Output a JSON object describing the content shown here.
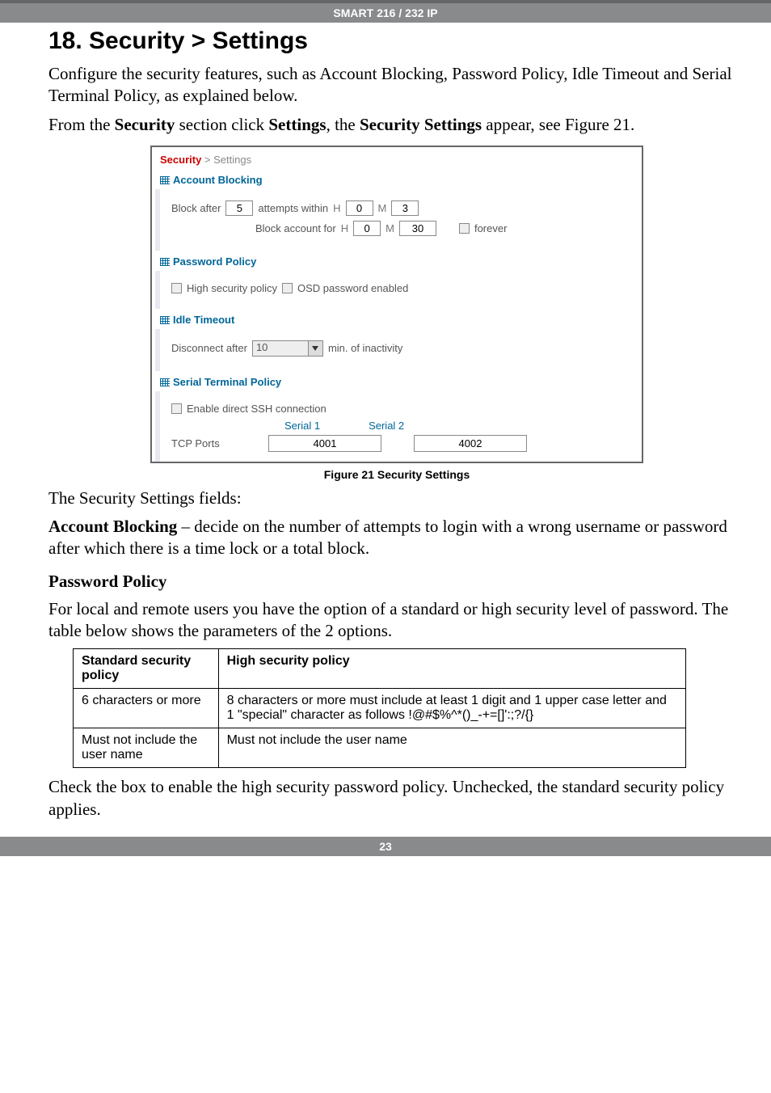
{
  "header": "SMART 216 / 232 IP",
  "title": "18. Security > Settings",
  "intro1": "Configure the security features, such as Account Blocking, Password Policy, Idle Timeout and Serial Terminal Policy, as explained below.",
  "intro2_pre": "From the ",
  "intro2_b1": "Security",
  "intro2_mid1": " section click ",
  "intro2_b2": "Settings",
  "intro2_mid2": ", the ",
  "intro2_b3": "Security Settings",
  "intro2_post": " appear, see Figure 21.",
  "win": {
    "crumb_sec": "Security",
    "crumb_gt": " > ",
    "crumb_set": "Settings",
    "account_blocking": {
      "title": "Account Blocking",
      "block_after_lbl": "Block after",
      "block_after_val": "5",
      "attempts_within": "attempts within",
      "aw_h": "0",
      "aw_m": "3",
      "block_account_for": "Block account for",
      "baf_h": "0",
      "baf_m": "30",
      "forever": "forever",
      "H": "H",
      "M": "M"
    },
    "password_policy": {
      "title": "Password Policy",
      "high": "High security policy",
      "osd": "OSD password enabled"
    },
    "idle": {
      "title": "Idle Timeout",
      "disconnect_after": "Disconnect after",
      "val": "10",
      "min": "min. of inactivity"
    },
    "serial": {
      "title": "Serial Terminal Policy",
      "enable": "Enable direct SSH connection",
      "s1": "Serial 1",
      "s2": "Serial 2",
      "tcp": "TCP Ports",
      "p1": "4001",
      "p2": "4002"
    }
  },
  "figcap": "Figure 21 Security Settings",
  "after1": "The Security Settings fields:",
  "after2_b": "Account Blocking",
  "after2_rest": " – decide on the number of attempts to login with a wrong username or password after which there is a time lock or a total block.",
  "pp_heading": "Password Policy",
  "pp_para": "For local and remote users you have the option of a standard or high security level of password. The table below shows the parameters of the 2 options.",
  "table": {
    "h1": "Standard security policy",
    "h2": "High security policy",
    "r1c1": "6 characters or more",
    "r1c2": "8 characters or more must include at least 1 digit and 1 upper case letter and 1 \"special\" character as follows !@#$%^*()_-+=[]':;?/{}",
    "r2c1": "Must not include the user name",
    "r2c2": "Must not include the user name"
  },
  "closing": "Check the box to enable the high security password policy. Unchecked, the standard security policy applies.",
  "pagenum": "23"
}
